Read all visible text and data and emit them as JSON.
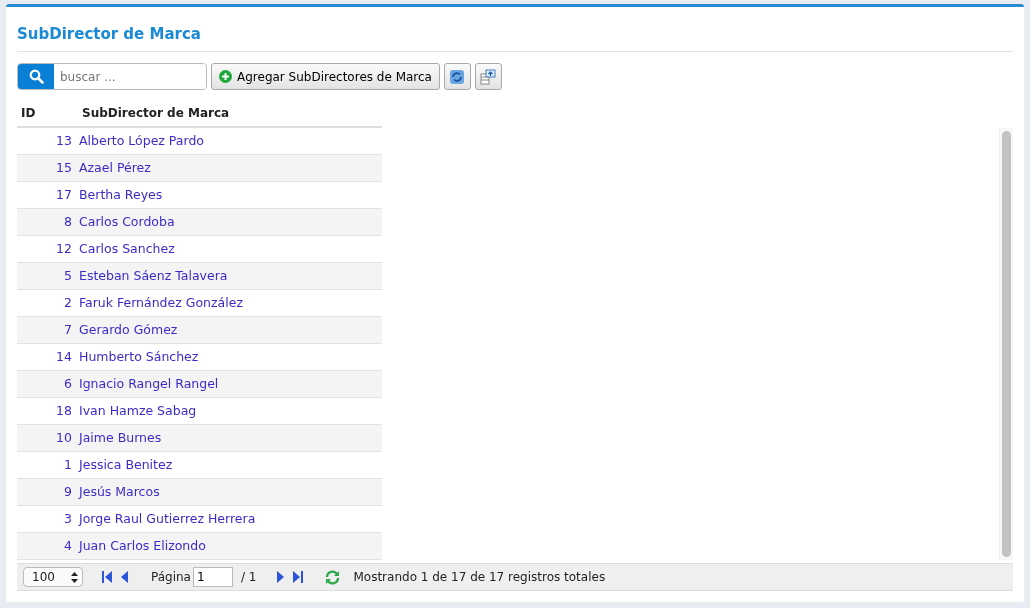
{
  "title": "SubDirector de Marca",
  "search": {
    "placeholder": "buscar ..."
  },
  "add_button": "Agregar SubDirectores de Marca",
  "table": {
    "columns": [
      "ID",
      "SubDirector de Marca"
    ],
    "rows": [
      {
        "id": "13",
        "name": "Alberto López Pardo"
      },
      {
        "id": "15",
        "name": "Azael Pérez"
      },
      {
        "id": "17",
        "name": "Bertha Reyes"
      },
      {
        "id": "8",
        "name": "Carlos Cordoba"
      },
      {
        "id": "12",
        "name": "Carlos Sanchez"
      },
      {
        "id": "5",
        "name": "Esteban Sáenz Talavera"
      },
      {
        "id": "2",
        "name": "Faruk Fernández González"
      },
      {
        "id": "7",
        "name": "Gerardo Gómez"
      },
      {
        "id": "14",
        "name": "Humberto Sánchez"
      },
      {
        "id": "6",
        "name": "Ignacio Rangel Rangel"
      },
      {
        "id": "18",
        "name": "Ivan Hamze Sabag"
      },
      {
        "id": "10",
        "name": "Jaime Burnes"
      },
      {
        "id": "1",
        "name": "Jessica Benitez"
      },
      {
        "id": "9",
        "name": "Jesús Marcos"
      },
      {
        "id": "3",
        "name": "Jorge Raul Gutierrez Herrera"
      },
      {
        "id": "4",
        "name": "Juan Carlos Elizondo"
      }
    ]
  },
  "pager": {
    "page_size": "100",
    "page_label": "Página",
    "page_value": "1",
    "page_total": "/ 1",
    "status": "Mostrando 1 de 17 de 17 registros totales"
  }
}
